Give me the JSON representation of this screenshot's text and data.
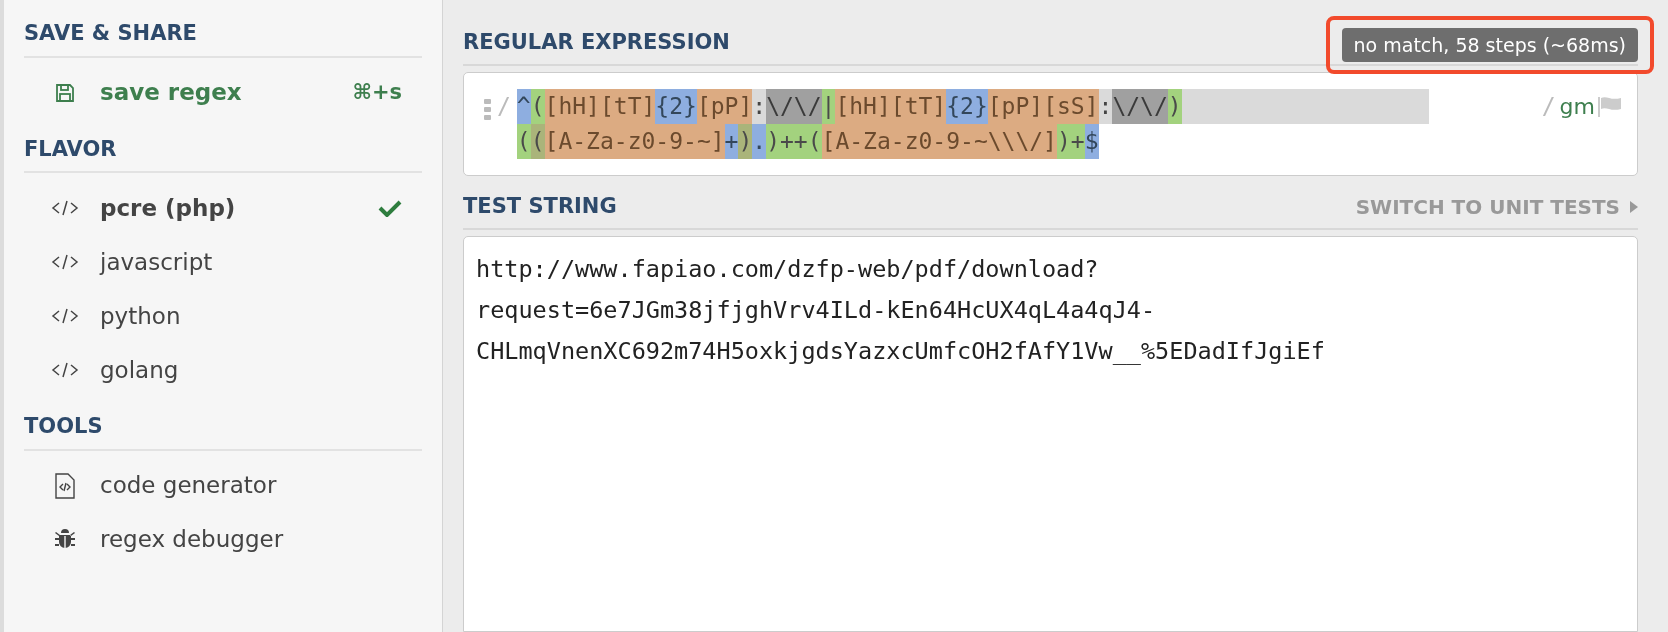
{
  "sidebar": {
    "sections": [
      {
        "title": "SAVE & SHARE",
        "items": [
          {
            "kind": "action",
            "label": "save regex",
            "shortcut": "⌘+s"
          }
        ]
      },
      {
        "title": "FLAVOR",
        "items": [
          {
            "kind": "flavor",
            "label": "pcre (php)",
            "selected": true
          },
          {
            "kind": "flavor",
            "label": "javascript",
            "selected": false
          },
          {
            "kind": "flavor",
            "label": "python",
            "selected": false
          },
          {
            "kind": "flavor",
            "label": "golang",
            "selected": false
          }
        ]
      },
      {
        "title": "TOOLS",
        "items": [
          {
            "kind": "codegen",
            "label": "code generator"
          },
          {
            "kind": "debugger",
            "label": "regex debugger"
          }
        ]
      }
    ]
  },
  "regex": {
    "title": "REGULAR EXPRESSION",
    "status": "no match, 58 steps (~68ms)",
    "status_highlighted": true,
    "delimiter_open": "/",
    "delimiter_close": "/",
    "flags": "gm",
    "lines": [
      [
        {
          "kind": "anchor",
          "text": "^"
        },
        {
          "kind": "group",
          "text": "("
        },
        {
          "kind": "class",
          "text": "[hH]"
        },
        {
          "kind": "class",
          "text": "[tT]"
        },
        {
          "kind": "quant",
          "text": "{2}"
        },
        {
          "kind": "class",
          "text": "[pP]"
        },
        {
          "kind": "plain",
          "text": ":"
        },
        {
          "kind": "escape",
          "text": "\\/\\/"
        },
        {
          "kind": "group",
          "text": "|"
        },
        {
          "kind": "class",
          "text": "[hH]"
        },
        {
          "kind": "class",
          "text": "[tT]"
        },
        {
          "kind": "quant",
          "text": "{2}"
        },
        {
          "kind": "class",
          "text": "[pP]"
        },
        {
          "kind": "class",
          "text": "[sS]"
        },
        {
          "kind": "plain",
          "text": ":"
        },
        {
          "kind": "escape",
          "text": "\\/\\/"
        },
        {
          "kind": "group",
          "text": ")"
        }
      ],
      [
        {
          "kind": "group",
          "text": "("
        },
        {
          "kind": "subgroup",
          "text": "("
        },
        {
          "kind": "class",
          "text": "[A-Za-z0-9-~]"
        },
        {
          "kind": "quant",
          "text": "+"
        },
        {
          "kind": "subgroup",
          "text": ")"
        },
        {
          "kind": "quant",
          "text": "."
        },
        {
          "kind": "group",
          "text": ")++("
        },
        {
          "kind": "class",
          "text": "[A-Za-z0-9-~\\\\\\/]"
        },
        {
          "kind": "group",
          "text": ")+"
        },
        {
          "kind": "anchor",
          "text": "$"
        }
      ]
    ]
  },
  "test": {
    "title": "TEST STRING",
    "switch_label": "SWITCH TO UNIT TESTS",
    "lines": [
      "http://www.fapiao.com/dzfp-web/pdf/download?",
      "request=6e7JGm38jfjghVrv4ILd-kEn64HcUX4qL4a4qJ4-",
      "CHLmqVnenXC692m74H5oxkjgdsYazxcUmfcOH2fAfY1Vw__%5EDadIfJgiEf"
    ]
  }
}
